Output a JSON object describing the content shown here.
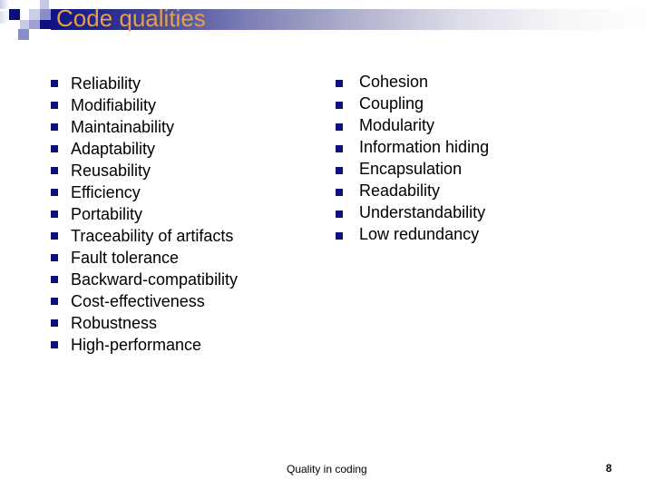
{
  "slide": {
    "title": "Code qualities",
    "left_list": [
      "Reliability",
      "Modifiability",
      "Maintainability",
      "Adaptability",
      "Reusability",
      "Efficiency",
      "Portability",
      "Traceability of artifacts",
      "Fault tolerance",
      "Backward-compatibility",
      "Cost-effectiveness",
      "Robustness",
      "High-performance"
    ],
    "right_list": [
      "Cohesion",
      "Coupling",
      "Modularity",
      "Information hiding",
      "Encapsulation",
      "Readability",
      "Understandability",
      "Low redundancy"
    ],
    "footer": "Quality in coding",
    "page_number": "8",
    "colors": {
      "title": "#e6a047",
      "bullet": "#0e1280",
      "title_bar_start": "#0f1384",
      "title_bar_end": "#ffffff"
    },
    "bullet_icon": "square-bullet-icon"
  }
}
